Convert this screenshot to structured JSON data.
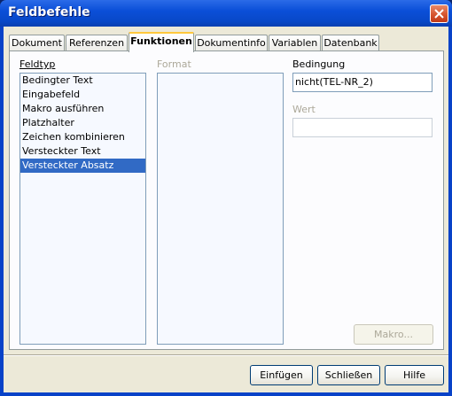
{
  "window": {
    "title": "Feldbefehle"
  },
  "tabs": [
    "Dokument",
    "Referenzen",
    "Funktionen",
    "Dokumentinfo",
    "Variablen",
    "Datenbank"
  ],
  "active_tab": "Funktionen",
  "feldtyp": {
    "label": "Feldtyp",
    "items": [
      "Bedingter Text",
      "Eingabefeld",
      "Makro ausführen",
      "Platzhalter",
      "Zeichen kombinieren",
      "Versteckter Text",
      "Versteckter Absatz"
    ],
    "selected": "Versteckter Absatz"
  },
  "format": {
    "label": "Format"
  },
  "bedingung": {
    "label": "Bedingung",
    "value": "nicht(TEL-NR_2)"
  },
  "wert": {
    "label": "Wert",
    "value": ""
  },
  "buttons": {
    "makro": "Makro...",
    "einfuegen": "Einfügen",
    "schliessen": "Schließen",
    "hilfe": "Hilfe"
  }
}
